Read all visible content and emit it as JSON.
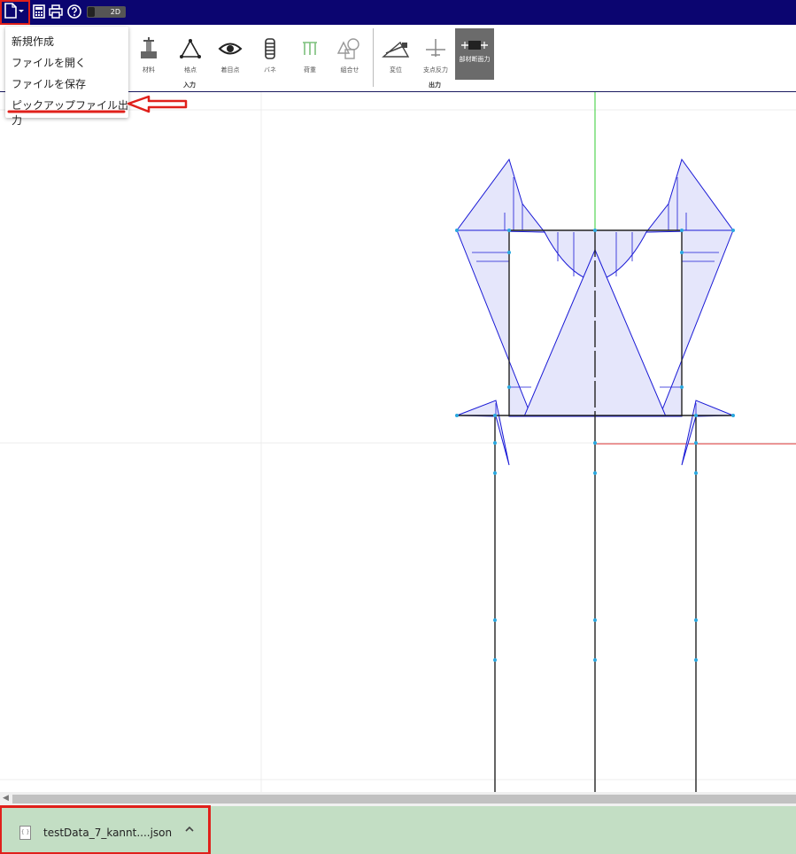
{
  "topbar": {
    "icons": [
      "file-icon",
      "calculator-icon",
      "printer-icon",
      "help-icon"
    ],
    "mode_label": "2D"
  },
  "toolbar": {
    "input_tools": [
      "材料",
      "格点",
      "着目点",
      "バネ",
      "荷重",
      "組合せ"
    ],
    "output_tools": [
      "変位",
      "支点反力",
      "部材断面力"
    ],
    "input_group_label": "入力",
    "output_group_label": "出力",
    "active_tool": "部材断面力"
  },
  "file_menu": {
    "items": [
      "新規作成",
      "ファイルを開く",
      "ファイルを保存",
      "ピックアップファイル出力"
    ]
  },
  "download_bar": {
    "filename": "testData_7_kannt....json",
    "file_icon_glyph": "{ }"
  },
  "colors": {
    "topbar": "#0b0570",
    "highlight_red": "#e0201b",
    "diagram_fill": "#e5e6fb",
    "diagram_stroke": "#1a1ad6",
    "axis_y": "#33cc33",
    "axis_x": "#e03a3a",
    "node": "#29a8e0",
    "download_bar": "#c3dec4"
  }
}
